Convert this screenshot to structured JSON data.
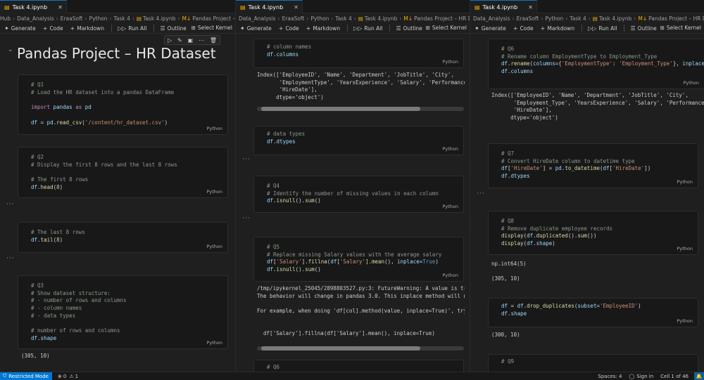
{
  "tab_label": "Task 4.ipynb",
  "breadcrumbs": [
    "Hub",
    "Data_Analysis",
    "EraaSoft",
    "Python",
    "Task 4",
    "Task 4.ipynb",
    "Pandas Project – HR Dataset"
  ],
  "toolbar": {
    "generate": "Generate",
    "code": "Code",
    "markdown": "Markdown",
    "run_all": "Run All",
    "outline": "Outline",
    "select_kernel": "Select Kernel"
  },
  "cell_lang": "Python",
  "pane1": {
    "title": "Pandas Project – HR Dataset",
    "cells": [
      {
        "lines": [
          "# Q1",
          "# Load the HR dataset into a pandas DataFrame",
          "",
          "import pandas as pd",
          "",
          "df = pd.read_csv('/content/hr_dataset.csv')"
        ]
      },
      {
        "lines": [
          "# Q2",
          "# Display the first 8 rows and the last 8 rows",
          "",
          "# The first 8 rows",
          "df.head(8)"
        ]
      },
      {
        "lines": [
          "# The last 8 rows",
          "df.tail(8)"
        ]
      },
      {
        "lines": [
          "# Q3",
          "# Show dataset structure:",
          "# - number of rows and columns",
          "# - column names",
          "# - data types",
          "",
          "# number of rows and columns",
          "df.shape"
        ]
      }
    ],
    "output_shape": "(305, 10)"
  },
  "pane2": {
    "cells": [
      {
        "lines": [
          "# column names",
          "df.columns"
        ]
      },
      {
        "lines": [
          "# data types",
          "df.dtypes"
        ]
      },
      {
        "lines": [
          "# Q4",
          "# Identify the number of missing values in each column",
          "df.isnull().sum()"
        ]
      },
      {
        "lines": [
          "# Q5",
          "# Replace missing Salary values with the average salary",
          "df['Salary'].fillna(df['Salary'].mean(), inplace=True)",
          "df.isnull().sum()"
        ]
      },
      {
        "lines": [
          "# Q6"
        ]
      }
    ],
    "output_columns": [
      "Index(['EmployeeID', 'Name', 'Department', 'JobTitle', 'City',",
      "       'EmploymentType', 'YearsExperience', 'Salary', 'PerformanceSco",
      "       'HireDate'],",
      "      dtype='object')"
    ],
    "output_warning": [
      "/tmp/ipykernel_25045/2898803527.py:3: FutureWarning: A value is tryin",
      "The behavior will change in pandas 3.0. This inplace method will neve",
      "",
      "For example, when doing 'df[col].method(value, inplace=True)', try us",
      "",
      "",
      "  df['Salary'].fillna(df['Salary'].mean(), inplace=True)"
    ]
  },
  "pane3": {
    "cells": [
      {
        "lines": [
          "# Q6",
          "# Rename column EmploymentType to Employment_Type",
          "df.rename(columns={'EmploymentType': 'Employment_Type'}, inplace=",
          "df.columns"
        ]
      },
      {
        "lines": [
          "# Q7",
          "# Convert HireDate column to datetime type",
          "df['HireDate'] = pd.to_datetime(df['HireDate'])",
          "df.dtypes"
        ]
      },
      {
        "lines": [
          "# Q8",
          "# Remove duplicate employee records",
          "display(df.duplicated().sum())",
          "display(df.shape)"
        ]
      },
      {
        "lines": [
          "df = df.drop_duplicates(subset='EmployeeID')",
          "df.shape"
        ]
      },
      {
        "lines": [
          "# Q9"
        ]
      }
    ],
    "output_columns": [
      "Index(['EmployeeID', 'Name', 'Department', 'JobTitle', 'City',",
      "       'Employment_Type', 'YearsExperience', 'Salary', 'PerformanceSc",
      "       'HireDate'],",
      "      dtype='object')"
    ],
    "output_dup1": "np.int64(5)",
    "output_dup2": "(305, 10)",
    "output_shape2": "(300, 10)"
  },
  "status": {
    "restricted": "Restricted Mode",
    "errors": "0",
    "warnings": "1",
    "spaces": "Spaces: 4",
    "sign_in": "Sign in",
    "cell_pos": "Cell 1 of 46"
  },
  "colors": {
    "accent": "#0078d4",
    "background": "#1f1f1f",
    "cell_bg": "#181818"
  }
}
